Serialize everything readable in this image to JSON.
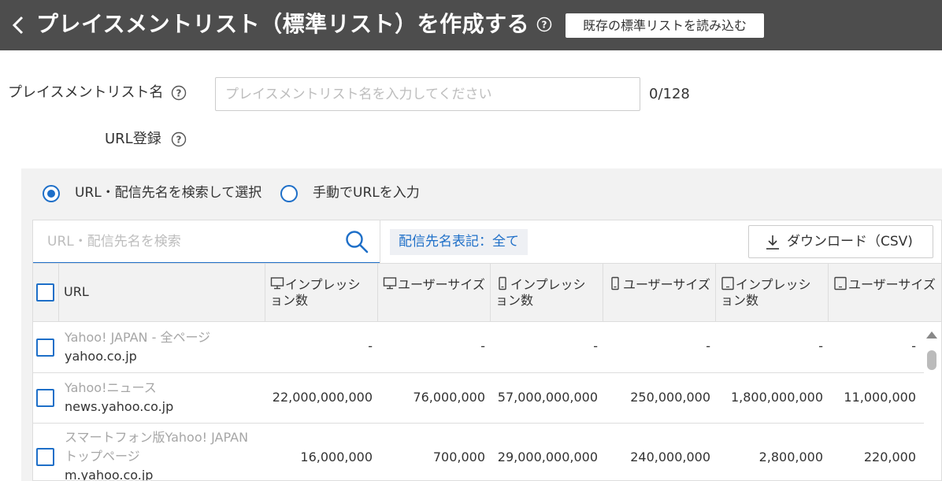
{
  "header": {
    "title": "プレイスメントリスト（標準リスト）を作成する",
    "load_button": "既存の標準リストを読み込む"
  },
  "form": {
    "name_label": "プレイスメントリスト名",
    "name_placeholder": "プレイスメントリスト名を入力してください",
    "name_value": "",
    "counter": "0/128",
    "url_label": "URL登録"
  },
  "mode": {
    "options": [
      {
        "label": "URL・配信先名を検索して選択",
        "selected": true
      },
      {
        "label": "手動でURLを入力",
        "selected": false
      }
    ]
  },
  "search": {
    "placeholder": "URL・配信先名を検索",
    "filter_tag": "配信先名表記：全て",
    "download_button": "ダウンロード（CSV)"
  },
  "table": {
    "columns": [
      {
        "label": "URL",
        "device": null
      },
      {
        "label": "インプレッション数",
        "device": "desktop-icon"
      },
      {
        "label": "ユーザーサイズ",
        "device": "desktop-icon"
      },
      {
        "label": "インプレッション数",
        "device": "smartphone-icon"
      },
      {
        "label": "ユーザーサイズ",
        "device": "smartphone-icon"
      },
      {
        "label": "インプレッション数",
        "device": "tablet-icon"
      },
      {
        "label": "ユーザーサイズ",
        "device": "tablet-icon"
      }
    ],
    "rows": [
      {
        "name": "Yahoo! JAPAN - 全ページ",
        "domain": "yahoo.co.jp",
        "values": [
          "-",
          "-",
          "-",
          "-",
          "-",
          "-"
        ]
      },
      {
        "name": "Yahoo!ニュース",
        "domain": "news.yahoo.co.jp",
        "values": [
          "22,000,000,000",
          "76,000,000",
          "57,000,000,000",
          "250,000,000",
          "1,800,000,000",
          "11,000,000"
        ]
      },
      {
        "name_line1": "スマートフォン版Yahoo! JAPAN",
        "name_line2": "トップページ",
        "domain": "m.yahoo.co.jp",
        "values": [
          "16,000,000",
          "700,000",
          "29,000,000,000",
          "240,000,000",
          "2,800,000",
          "220,000"
        ]
      }
    ]
  },
  "colors": {
    "header_bg": "#4d4d4d",
    "accent": "#1e6fc8",
    "panel_bg": "#f2f2f2"
  }
}
